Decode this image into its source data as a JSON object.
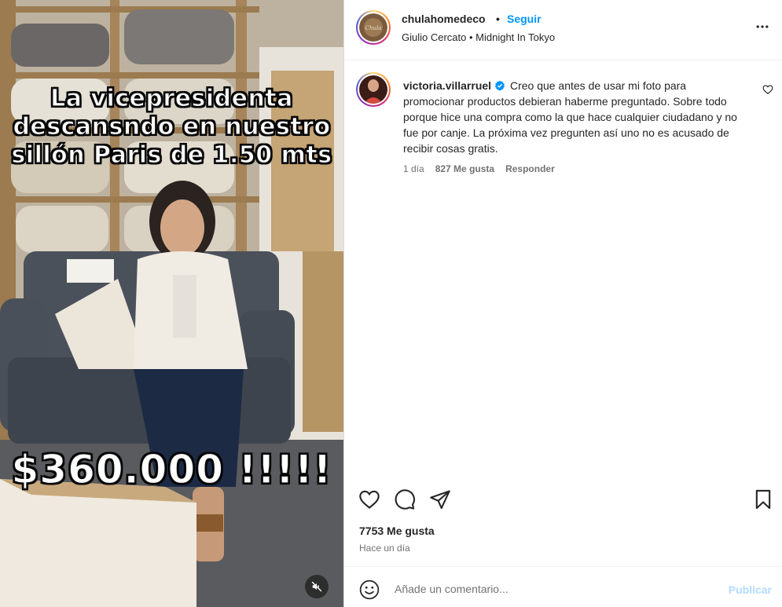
{
  "media": {
    "caption_lines": [
      "La vicepresidenta",
      "descansndo en nuestro",
      "sillón Paris de 1.50 mts"
    ],
    "price": "$360.000 !!!!!"
  },
  "header": {
    "username": "chulahomedeco",
    "separator": "•",
    "follow_label": "Seguir",
    "audio": "Giulio Cercato • Midnight In Tokyo"
  },
  "comment": {
    "username": "victoria.villarruel",
    "verified": true,
    "text": "Creo que antes de usar mi foto para promocionar productos debieran haberme preguntado. Sobre todo porque hice una compra como la que hace cualquier ciudadano y no fue por canje. La próxima vez pregunten así uno no es acusado de recibir cosas gratis.",
    "age": "1 día",
    "likes": "827 Me gusta",
    "reply_label": "Responder"
  },
  "post": {
    "likes": "7753 Me gusta",
    "time": "Hace un día"
  },
  "composer": {
    "placeholder": "Añade un comentario...",
    "publish_label": "Publicar"
  },
  "colors": {
    "accent": "#0095f6",
    "publish_disabled": "#b3dbff",
    "muted_text": "#737373",
    "verified": "#0095f6"
  }
}
